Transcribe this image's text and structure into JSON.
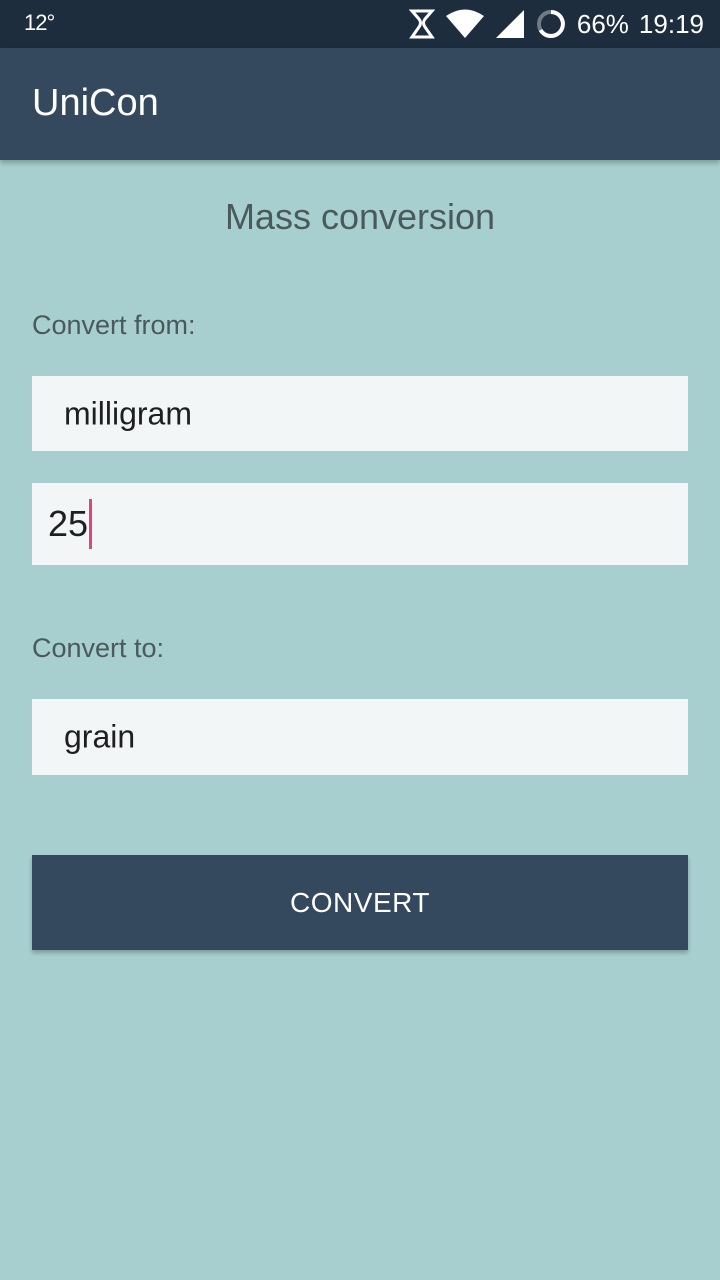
{
  "status_bar": {
    "temperature": "12°",
    "battery_percent": "66%",
    "time": "19:19",
    "icons": [
      "data-sync-icon",
      "wifi-icon",
      "cell-signal-icon",
      "battery-ring-icon"
    ]
  },
  "app_bar": {
    "title": "UniCon"
  },
  "main": {
    "title": "Mass conversion",
    "from_label": "Convert from:",
    "from_unit": "milligram",
    "amount_value": "25",
    "to_label": "Convert to:",
    "to_unit": "grain",
    "convert_label": "CONVERT"
  },
  "colors": {
    "status_bar_bg": "#1d2d3d",
    "app_bar_bg": "#34495e",
    "background": "#a8cfcf",
    "field_bg": "#f3f6f6",
    "cursor": "#e0457b"
  }
}
